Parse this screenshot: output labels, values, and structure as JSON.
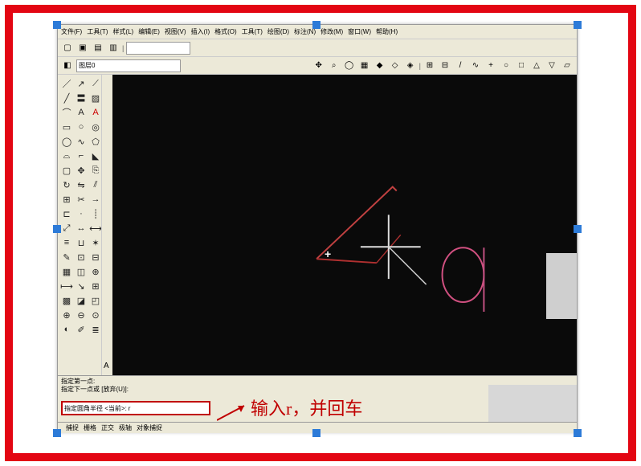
{
  "menu": {
    "items": [
      "文件(F)",
      "工具(T)",
      "样式(L)",
      "编辑(E)",
      "视图(V)",
      "插入(I)",
      "格式(O)",
      "工具(T)",
      "绘图(D)",
      "标注(N)",
      "修改(M)",
      "窗口(W)",
      "帮助(H)"
    ]
  },
  "toolbar1": {
    "icons": [
      "new",
      "open",
      "save",
      "print"
    ]
  },
  "toolbar2": {
    "layer_combo": "图层0",
    "right_icons": [
      "pan",
      "zoom",
      "3d",
      "orbit",
      "view",
      "a",
      "b",
      "c",
      "d",
      "e",
      "f",
      "g",
      "h",
      "i",
      "j",
      "k",
      "l",
      "m",
      "n"
    ]
  },
  "palette": [
    "line",
    "ray",
    "pline",
    "xline",
    "mline",
    "hatch",
    "arc",
    "text",
    "A",
    "rect",
    "circ",
    "don",
    "ell",
    "spln",
    "poly",
    "arc2",
    "fil",
    "cham",
    "rec2",
    "move",
    "copy",
    "rot",
    "mir",
    "off",
    "arr",
    "trim",
    "ext",
    "br",
    "pt",
    "div",
    "scl",
    "str",
    "len",
    "ali",
    "jn",
    "exp",
    "ed",
    "grp",
    "ung",
    "tb",
    "blk",
    "ins",
    "dim",
    "ldr",
    "tol",
    "ha",
    "reg",
    "bnd",
    "z",
    "z2",
    "z3",
    "or",
    "pd",
    "ol"
  ],
  "command": {
    "history_line1": "指定第一点:",
    "history_line2": "指定下一点或 [放弃(U)]:",
    "prompt": "指定圆角半径 <当前>:",
    "prompt_suffix": "r"
  },
  "annotation": {
    "text": "输入r，并回车"
  },
  "status": {
    "coords": "",
    "mode_snap": "捕捉",
    "mode_grid": "栅格",
    "mode_ortho": "正交",
    "mode_polar": "极轴",
    "mode_osnap": "对象捕捉"
  }
}
